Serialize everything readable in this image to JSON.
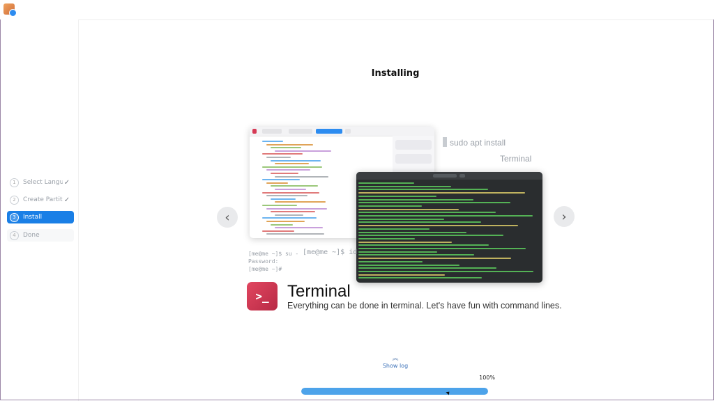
{
  "sidebar": {
    "steps": [
      {
        "num": "1",
        "label": "Select Langu...",
        "state": "done"
      },
      {
        "num": "2",
        "label": "Create Partiti...",
        "state": "done"
      },
      {
        "num": "3",
        "label": "Install",
        "state": "active"
      },
      {
        "num": "4",
        "label": "Done",
        "state": "pending"
      }
    ],
    "check_glyph": "✓"
  },
  "main": {
    "heading": "Installing",
    "prev_glyph": "‹",
    "next_glyph": "›"
  },
  "slide": {
    "ghost_sudo": "sudo apt install",
    "ghost_terminal": "Terminal",
    "ghost_prompt1": "[me@me ~]$ su -",
    "ghost_prompt2": "Password:",
    "ghost_prompt3": "[me@me ~]#",
    "ghost_prompt_id": "[me@me ~]$ id",
    "icon_glyph": ">_",
    "title": "Terminal",
    "description": "Everything can be done in terminal. Let's have fun with command lines."
  },
  "footer": {
    "show_log_label": "Show log",
    "show_log_icon": "chevron-up-icon",
    "percent_label": "100%",
    "progress": 1.0
  },
  "colors": {
    "accent": "#1a7fe6",
    "progress_fill": "#4da3ea",
    "terminal_icon": "#d63a55"
  }
}
